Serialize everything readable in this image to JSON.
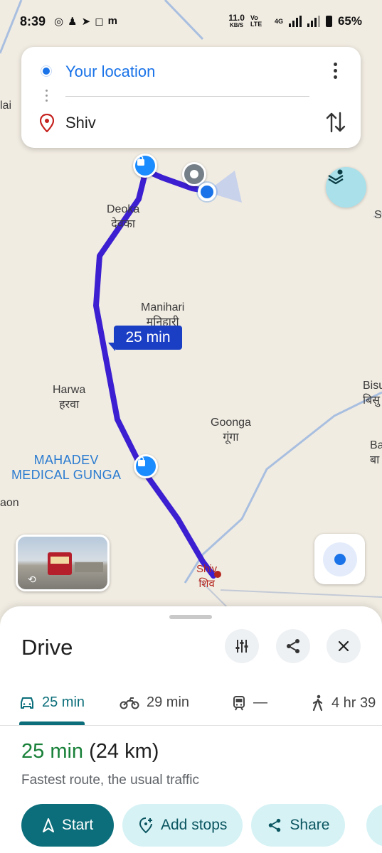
{
  "status_bar": {
    "time": "8:39",
    "apps": [
      "whatsapp-icon",
      "snapchat-icon",
      "telegram-icon",
      "instagram-icon",
      "m-icon"
    ],
    "net_speed": "11.0",
    "net_speed_unit": "KB/S",
    "volte": "Vo LTE",
    "network": "4G",
    "battery": "65%"
  },
  "route_inputs": {
    "origin": "Your location",
    "destination": "Shiv"
  },
  "map": {
    "route_color": "#3b1fd1",
    "route_badge": "25 min",
    "places": {
      "deoka_en": "Deoka",
      "deoka_hi": "देवका",
      "manihari_en": "Manihari",
      "manihari_hi": "मनिहारी",
      "harwa_en": "Harwa",
      "harwa_hi": "हरवा",
      "goonga_en": "Goonga",
      "goonga_hi": "गूंगा",
      "mahadev_1": "MAHADEV",
      "mahadev_2": "MEDICAL GUNGA",
      "shiv_en": "Shiv",
      "shiv_hi": "शिव",
      "edge_lai": "lai",
      "edge_aon": "aon",
      "edge_bisu": "Bisu",
      "edge_bisu_hi": "बिसु",
      "edge_ba": "Ba",
      "edge_ba_hi": "बा",
      "edge_s": "S"
    }
  },
  "sheet": {
    "title": "Drive",
    "modes": [
      {
        "icon": "car-icon",
        "label": "25 min"
      },
      {
        "icon": "motorbike-icon",
        "label": "29 min"
      },
      {
        "icon": "train-icon",
        "label": "—"
      },
      {
        "icon": "walk-icon",
        "label": "4 hr 39"
      }
    ],
    "duration": "25 min",
    "distance": "(24 km)",
    "description": "Fastest route, the usual traffic",
    "actions": {
      "start": "Start",
      "add_stops": "Add stops",
      "share": "Share"
    }
  },
  "colors": {
    "accent": "#0b6e7a",
    "blue": "#1a73e8",
    "green": "#188038"
  }
}
